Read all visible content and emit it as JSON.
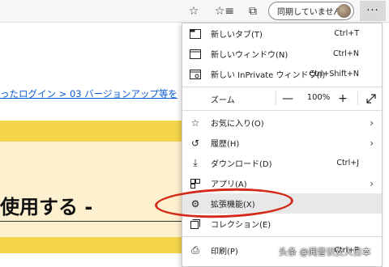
{
  "toolbar": {
    "sync_label": "同期していません",
    "more_label": "···"
  },
  "page": {
    "breadcrumb": "ったログイン  > 03 バージョンアップ等を",
    "heading": "使用する -"
  },
  "menu": {
    "items": [
      {
        "label": "新しいタブ(T)",
        "shortcut": "Ctrl+T",
        "icon": "new-tab-icon"
      },
      {
        "label": "新しいウィンドウ(N)",
        "shortcut": "Ctrl+N",
        "icon": "new-window-icon"
      },
      {
        "label": "新しい InPrivate ウィンドウ(I)",
        "shortcut": "Ctrl+Shift+N",
        "icon": "inprivate-icon"
      },
      {
        "label": "お気に入り(O)",
        "shortcut": "",
        "icon": "favorites-icon"
      },
      {
        "label": "履歴(H)",
        "shortcut": "",
        "icon": "history-icon"
      },
      {
        "label": "ダウンロード(D)",
        "shortcut": "Ctrl+J",
        "icon": "download-icon"
      },
      {
        "label": "アプリ(A)",
        "shortcut": "",
        "icon": "apps-icon"
      },
      {
        "label": "拡張機能(X)",
        "shortcut": "",
        "icon": "extensions-icon"
      },
      {
        "label": "コレクション(E)",
        "shortcut": "",
        "icon": "collections-icon"
      },
      {
        "label": "印刷(P)",
        "shortcut": "Ctrl+P",
        "icon": "print-icon"
      }
    ],
    "zoom": {
      "label": "ズーム",
      "minus": "—",
      "value": "100%",
      "plus": "+"
    }
  },
  "watermark": "头条 @闻音识女人日本"
}
